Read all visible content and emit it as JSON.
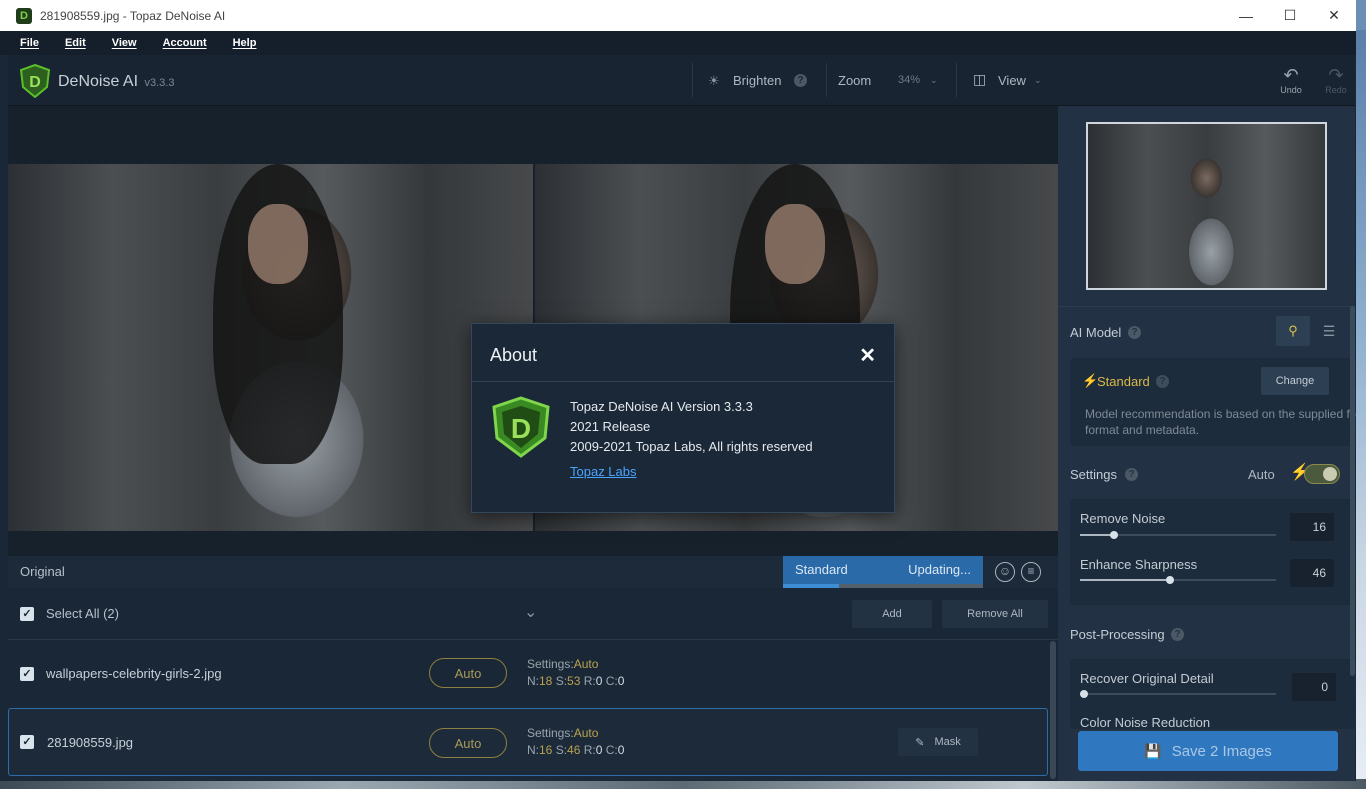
{
  "titlebar": {
    "title": "281908559.jpg - Topaz DeNoise AI",
    "minimize": "—",
    "maximize": "☐",
    "close": "✕"
  },
  "menu": [
    "File",
    "Edit",
    "View",
    "Account",
    "Help"
  ],
  "toolbar": {
    "app_name": "DeNoise AI",
    "version": "v3.3.3",
    "brighten": "Brighten",
    "zoom_label": "Zoom",
    "zoom_value": "34%",
    "view": "View",
    "undo": "Undo",
    "redo": "Redo"
  },
  "preview": {
    "original_label": "Original",
    "model_label": "Standard",
    "status": "Updating...",
    "progress": 0.28
  },
  "list": {
    "select_all": "Select All (2)",
    "add": "Add",
    "remove_all": "Remove All",
    "settings_label": "Settings:",
    "files": [
      {
        "name": "wallpapers-celebrity-girls-2.jpg",
        "mode": "Auto",
        "settings": "Auto",
        "n": "18",
        "s": "53",
        "r": "0",
        "c": "0"
      },
      {
        "name": "281908559.jpg",
        "mode": "Auto",
        "settings": "Auto",
        "n": "16",
        "s": "46",
        "r": "0",
        "c": "0",
        "mask": "Mask"
      }
    ]
  },
  "panel": {
    "ai_model": "AI Model",
    "model_name": "Standard",
    "change": "Change",
    "model_note": "Model recommendation is based on the supplied file format and metadata.",
    "settings": "Settings",
    "auto": "Auto",
    "remove_noise": {
      "label": "Remove Noise",
      "value": "16"
    },
    "enhance_sharpness": {
      "label": "Enhance Sharpness",
      "value": "46"
    },
    "post_processing": "Post-Processing",
    "recover_detail": {
      "label": "Recover Original Detail",
      "value": "0"
    },
    "color_noise_partial": "Color Noise Reduction",
    "save": "Save 2 Images"
  },
  "about": {
    "title": "About",
    "close": "✕",
    "line1": "Topaz DeNoise AI Version 3.3.3",
    "line2": "2021 Release",
    "line3": "2009-2021 Topaz Labs, All rights reserved",
    "link": "Topaz Labs"
  },
  "colors": {
    "accent": "#2f78bf",
    "auto_gold": "#a79a5a",
    "brand_green": "#5cbf2a"
  }
}
